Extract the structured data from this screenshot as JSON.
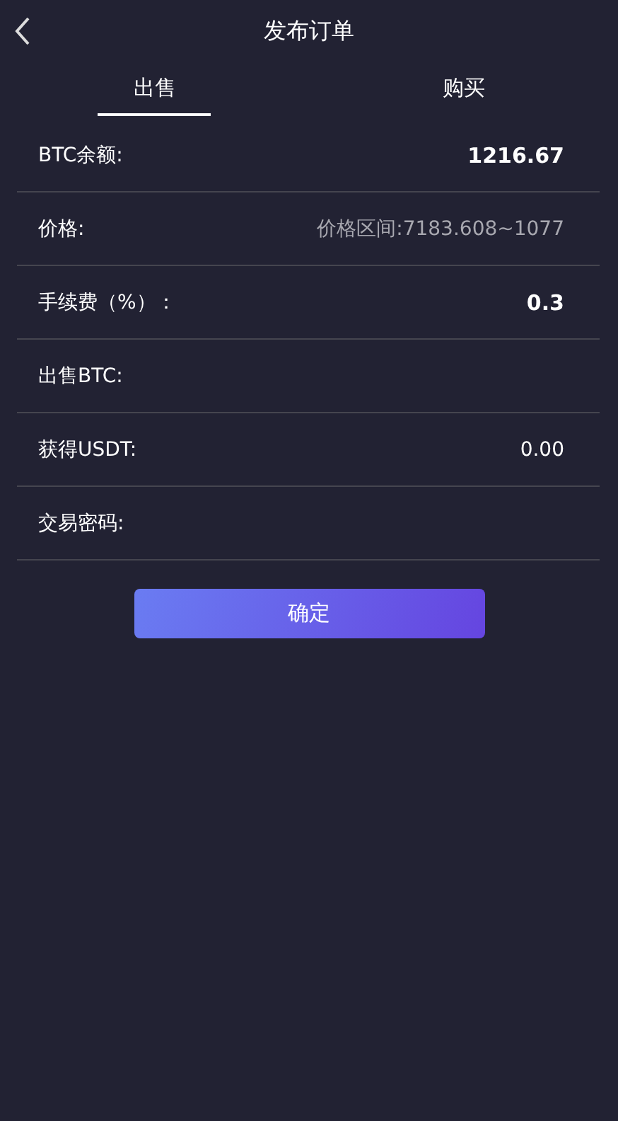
{
  "header": {
    "back_icon": true,
    "title": "发布订单"
  },
  "tabs": [
    {
      "label": "出售",
      "selected": true
    },
    {
      "label": "购买",
      "selected": false
    }
  ],
  "rows": [
    {
      "kind": "value",
      "label": "BTC余额:",
      "value": "1216.67",
      "bold": true
    },
    {
      "kind": "input",
      "label": "价格:",
      "placeholder": "价格区间:7183.608~1077"
    },
    {
      "kind": "value",
      "label": "手续费（%）：",
      "value": "0.3",
      "bold": true
    },
    {
      "kind": "input",
      "label": "出售BTC:"
    },
    {
      "kind": "value",
      "label": "获得USDT:",
      "value": "0.00",
      "bold": false
    },
    {
      "kind": "input",
      "label": "交易密码:"
    }
  ],
  "confirm_button": "确定"
}
